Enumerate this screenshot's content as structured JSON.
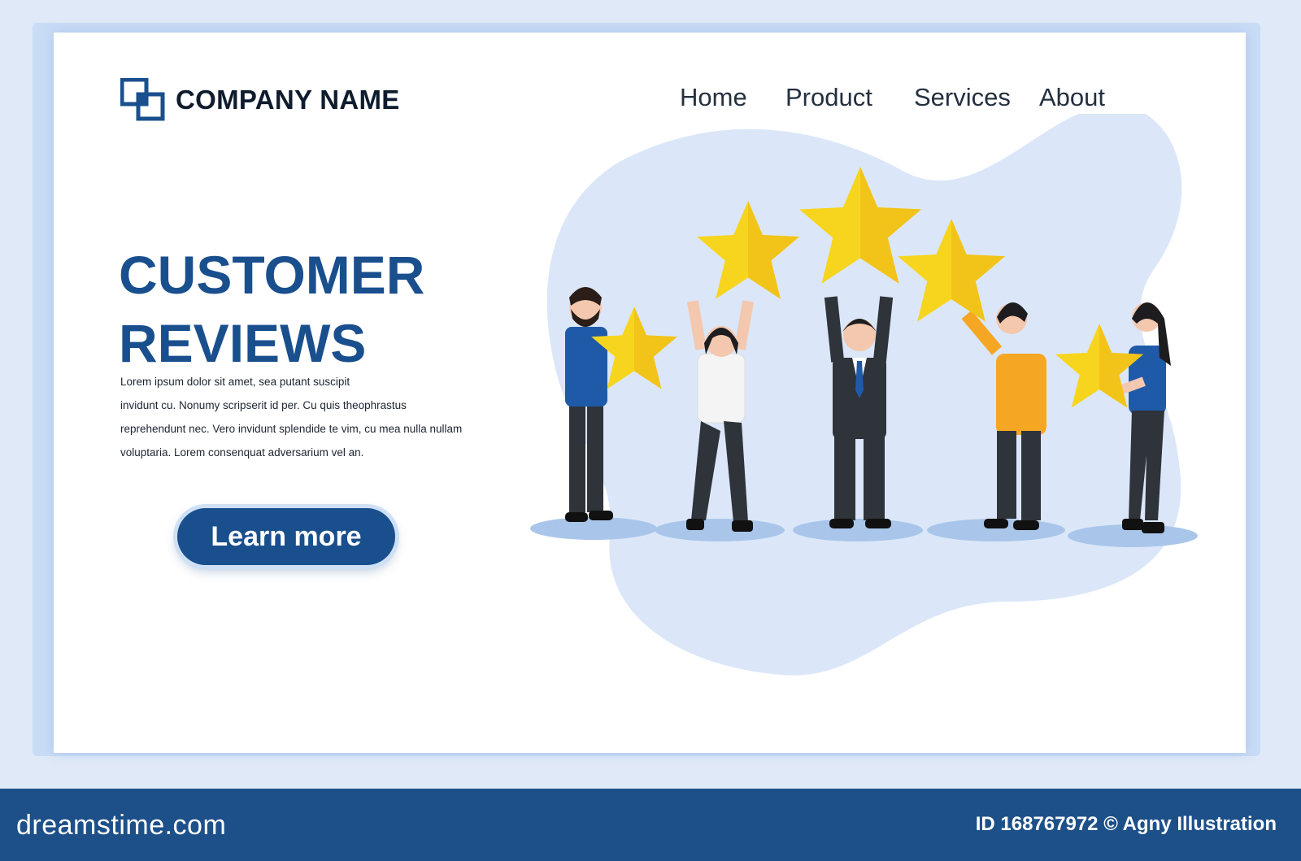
{
  "brand": {
    "name": "COMPANY NAME",
    "logo_icon": "overlapping-squares-logo-icon"
  },
  "nav": {
    "items": [
      {
        "label": "Home"
      },
      {
        "label": "Product"
      },
      {
        "label": "Services"
      },
      {
        "label": "About"
      }
    ]
  },
  "hero": {
    "title_line1": "CUSTOMER",
    "title_line2": "REVIEWS",
    "body_line1": "Lorem ipsum dolor sit amet, sea putant suscipit",
    "body_line2": "invidunt cu. Nonumy scripserit id per. Cu quis theophrastus",
    "body_line3": "reprehendunt nec. Vero invidunt splendide te vim, cu mea nulla nullam",
    "body_line4": "voluptaria. Lorem consenquat adversarium vel an.",
    "cta_label": "Learn more"
  },
  "illustration": {
    "description_icon": "five-people-holding-stars-illustration",
    "star_count": 5
  },
  "footer": {
    "site": "dreamstime.com",
    "credit": "ID 168767972 © Agny Illustration"
  },
  "colors": {
    "accent": "#1a4f8e",
    "footer": "#1d5089",
    "star": "#f7d51e",
    "blob": "#dbe7f8"
  }
}
